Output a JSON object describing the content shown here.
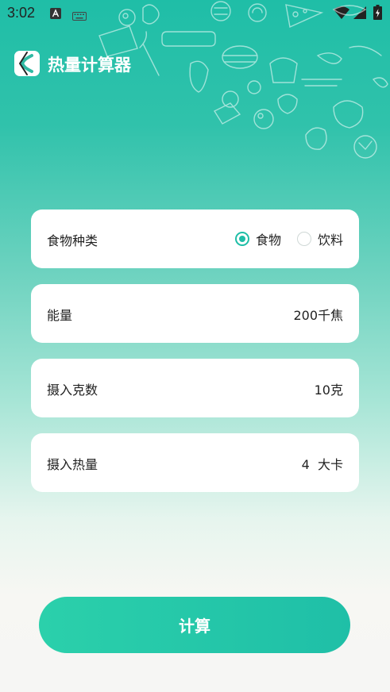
{
  "status_bar": {
    "time": "3:02",
    "icons": [
      "a-letter-icon",
      "keyboard-icon",
      "wifi-icon",
      "signal-icon",
      "battery-charging-icon"
    ]
  },
  "header": {
    "title": "热量计算器",
    "back_icon": "chevron-left-icon"
  },
  "form": {
    "food_type": {
      "label": "食物种类",
      "options": [
        {
          "label": "食物",
          "checked": true
        },
        {
          "label": "饮料",
          "checked": false
        }
      ]
    },
    "energy": {
      "label": "能量",
      "value": "200千焦"
    },
    "grams": {
      "label": "摄入克数",
      "value": "10克"
    },
    "calories": {
      "label": "摄入热量",
      "value": "4  大卡"
    }
  },
  "calculate_button": {
    "label": "计算"
  },
  "colors": {
    "accent": "#1fbea7",
    "card_bg": "#ffffff"
  }
}
